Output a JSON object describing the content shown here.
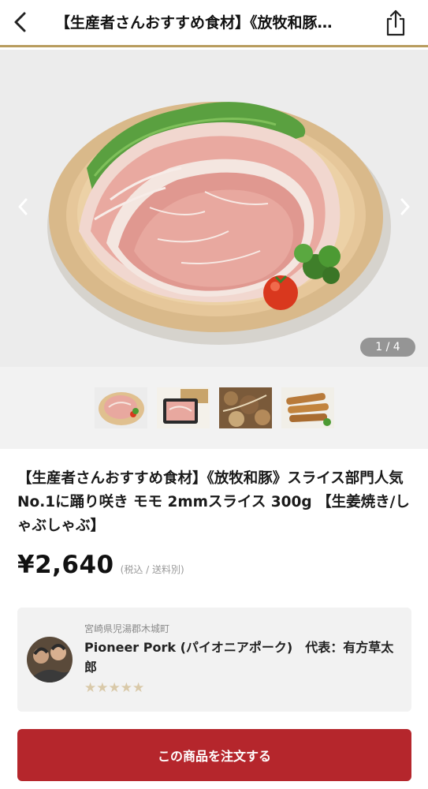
{
  "header": {
    "title": "【生産者さんおすすめ食材】《放牧和豚…",
    "back_icon": "chevron-left-icon",
    "share_icon": "share-icon"
  },
  "gallery": {
    "counter": "1 / 4",
    "prev_icon": "chevron-left-icon",
    "next_icon": "chevron-right-icon",
    "thumbnails": [
      {
        "name": "thumb-sliced-pork-plate"
      },
      {
        "name": "thumb-packaged-pork"
      },
      {
        "name": "thumb-stir-fried-pork"
      },
      {
        "name": "thumb-fried-pork-rolls"
      }
    ]
  },
  "product": {
    "title": "【生産者さんおすすめ食材】《放牧和豚》スライス部門人気No.1に踊り咲き モモ 2mmスライス 300g 【生姜焼き/しゃぶしゃぶ】",
    "price": "¥2,640",
    "price_note": "(税込 / 送料別)"
  },
  "seller": {
    "location": "宮崎県児湯郡木城町",
    "name": "Pioneer Pork (パイオニアポーク)　代表：有方草太郎",
    "rating_stars": "★★★★★"
  },
  "order_button": {
    "label": "この商品を注文する"
  },
  "colors": {
    "accent_gold": "#b89c5e",
    "order_red": "#b5262c",
    "star": "#d9c9a9"
  }
}
